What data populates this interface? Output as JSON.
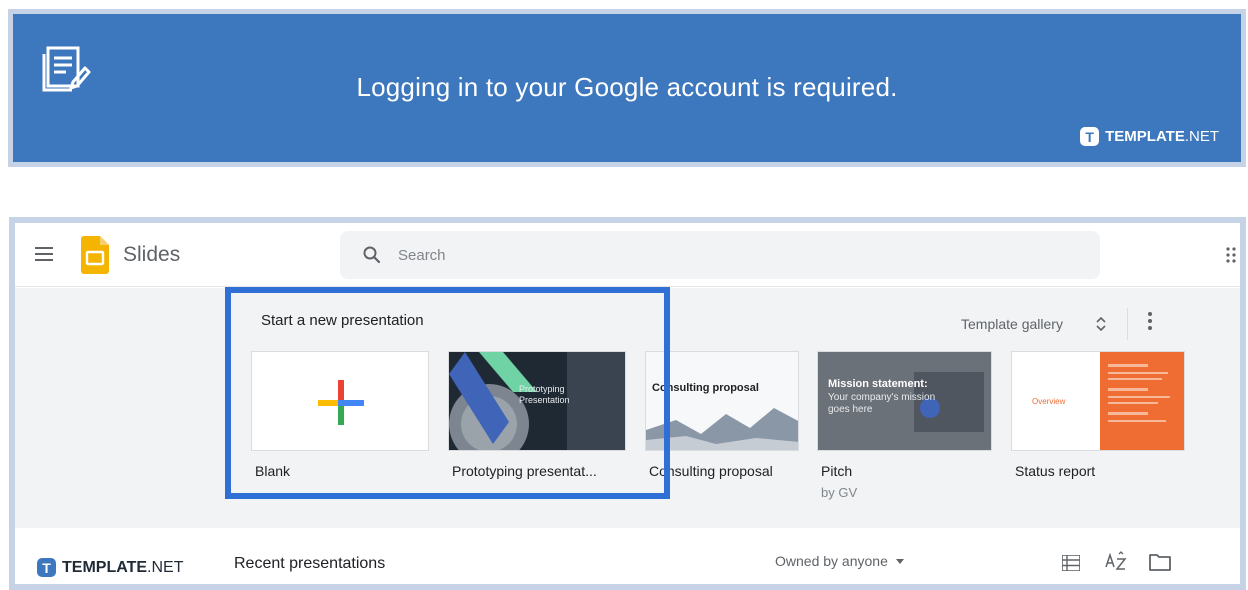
{
  "banner": {
    "message": "Logging in to your Google account is required.",
    "icon": "document-edit-icon",
    "brand_bold": "TEMPLATE",
    "brand_light": ".NET",
    "brand_mark": "T"
  },
  "topbar": {
    "app_name": "Slides",
    "search_placeholder": "Search"
  },
  "templates": {
    "heading": "Start a new presentation",
    "gallery_label": "Template gallery",
    "items": [
      {
        "name": "Blank"
      },
      {
        "name": "Prototyping presentat...",
        "thumb_title": "Prototyping Presentation"
      },
      {
        "name": "Consulting proposal",
        "thumb_title": "Consulting proposal"
      },
      {
        "name": "Pitch",
        "subtitle": "by GV",
        "thumb_title": "Mission statement:",
        "thumb_body": "Your company's mission goes here"
      },
      {
        "name": "Status report",
        "thumb_title": "Overview"
      }
    ]
  },
  "bottom": {
    "brand_bold": "TEMPLATE",
    "brand_light": ".NET",
    "brand_mark": "T",
    "recent_label": "Recent presentations",
    "owner_filter": "Owned by anyone"
  },
  "colors": {
    "banner_bg": "#3d77bd",
    "highlight": "#2f6fd6",
    "slides_yellow": "#f4b400",
    "status_orange": "#ef6d33"
  }
}
